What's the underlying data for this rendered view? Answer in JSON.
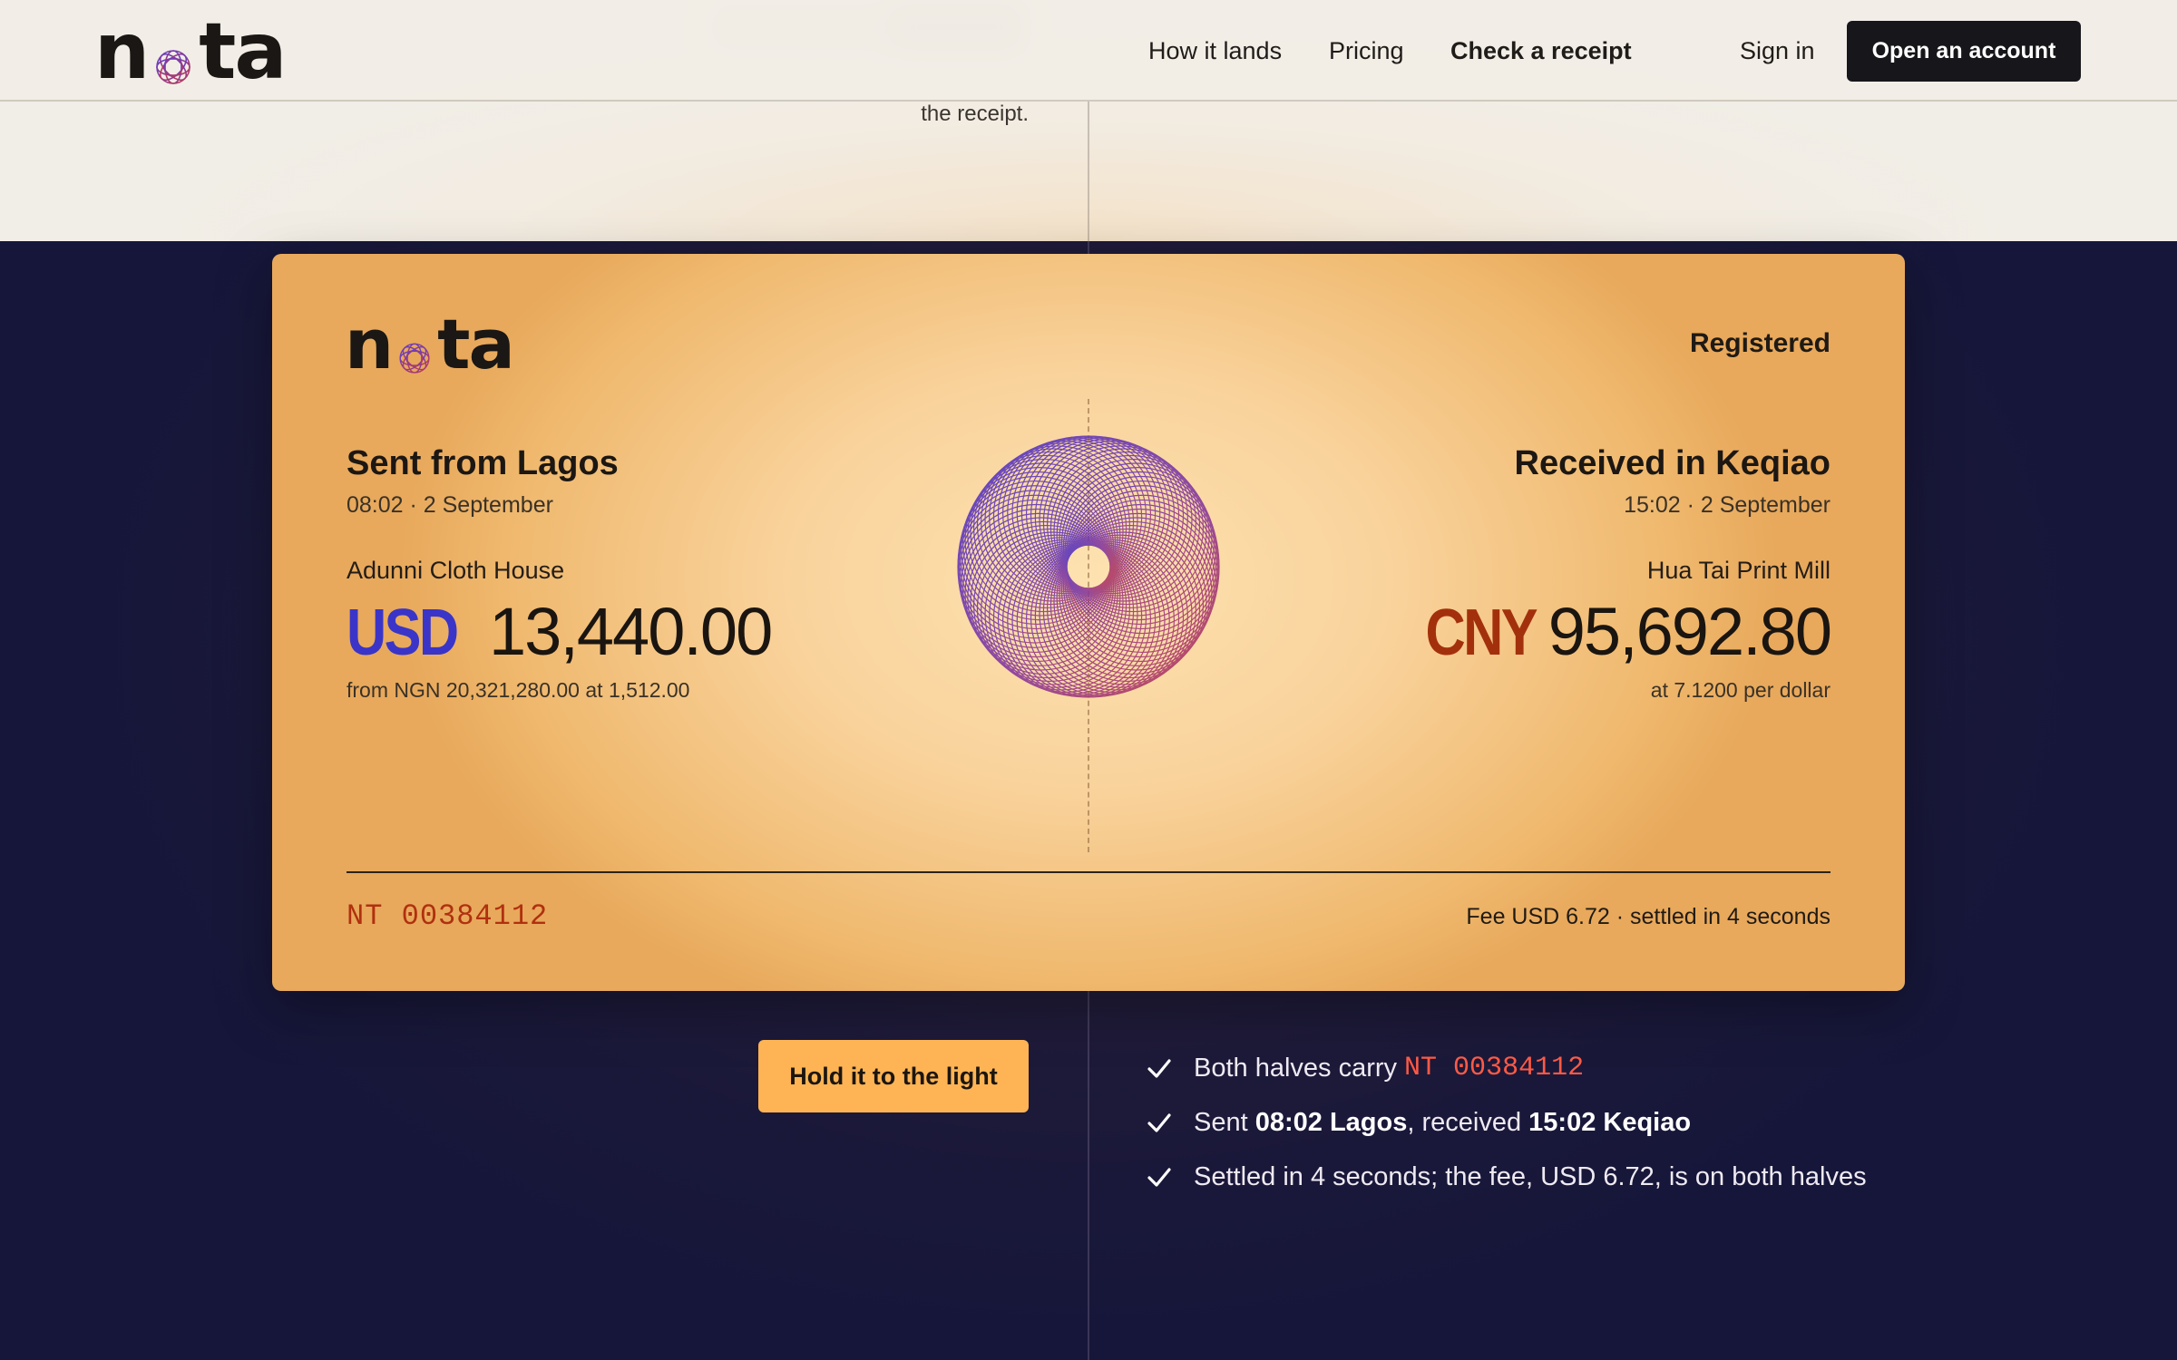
{
  "brand": {
    "name_start": "n",
    "name_end": "ta"
  },
  "nav": {
    "how": "How it lands",
    "pricing": "Pricing",
    "check": "Check a receipt",
    "signin": "Sign in",
    "open_account": "Open an account"
  },
  "intro": {
    "caption_tail": "the receipt."
  },
  "receipt": {
    "status": "Registered",
    "sent": {
      "place": "Sent from Lagos",
      "time": "08:02 · 2 September",
      "party": "Adunni Cloth House",
      "currency": "USD",
      "amount": "13,440.00",
      "conversion": "from NGN 20,321,280.00 at 1,512.00"
    },
    "received": {
      "place": "Received in Keqiao",
      "time": "15:02 · 2 September",
      "party": "Hua Tai Print Mill",
      "currency": "CNY",
      "amount": "95,692.80",
      "conversion": "at 7.1200 per dollar"
    },
    "serial": "NT 00384112",
    "fee_line": "Fee USD 6.72 · settled in 4 seconds"
  },
  "actions": {
    "hold": "Hold it to the light"
  },
  "checks": {
    "c1_text": "Both halves carry",
    "c1_code": "NT 00384112",
    "c2_a": "Sent",
    "c2_b": "08:02 Lagos",
    "c2_c": ", received",
    "c2_d": "15:02 Keqiao",
    "c3": "Settled in 4 seconds; the fee, USD 6.72, is on both halves"
  },
  "colors": {
    "accent_blue": "#3a35c8",
    "accent_rust": "#a3300c",
    "button_amber": "#feb454",
    "navy": "#15163a",
    "code_red": "#ff5a45"
  },
  "icons": {
    "check": "check-icon",
    "logo_ring": "logo-ring-icon",
    "rosette": "guilloche-rosette"
  }
}
